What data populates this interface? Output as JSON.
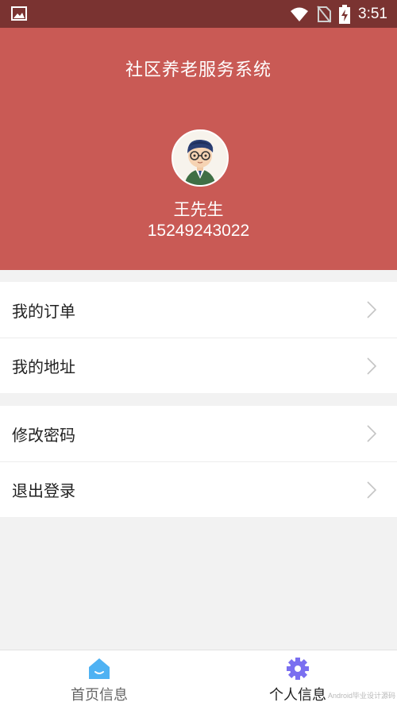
{
  "status_bar": {
    "time": "3:51"
  },
  "header": {
    "title": "社区养老服务系统",
    "user_name": "王先生",
    "phone": "15249243022"
  },
  "menu": {
    "group1": [
      {
        "label": "我的订单"
      },
      {
        "label": "我的地址"
      }
    ],
    "group2": [
      {
        "label": "修改密码"
      },
      {
        "label": "退出登录"
      }
    ]
  },
  "bottom_nav": {
    "home_label": "首页信息",
    "profile_label": "个人信息"
  },
  "watermark": "Android毕业设计源码",
  "colors": {
    "header_bg": "#c95a55",
    "status_bar_bg": "#7a3331",
    "home_icon": "#4fb2f3",
    "profile_icon": "#7a6ff0"
  }
}
